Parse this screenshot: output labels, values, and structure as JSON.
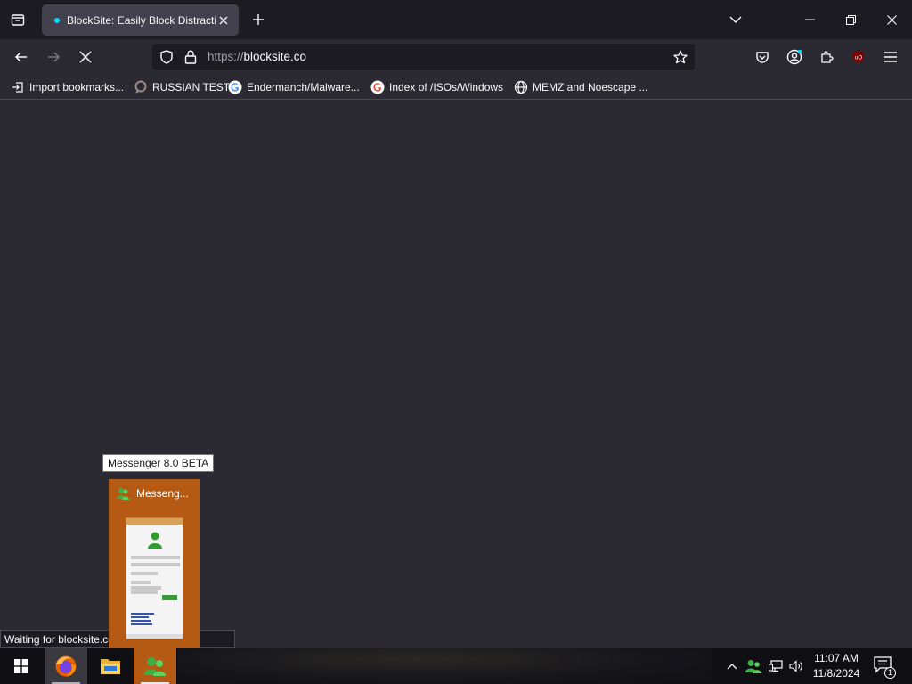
{
  "browser": {
    "active_tab_title": "BlockSite: Easily Block Distractio",
    "url_scheme": "https://",
    "url_host": "blocksite.co",
    "status_text": "Waiting for blocksite.co...",
    "colors": {
      "accent": "#00ddff",
      "chrome": "#1c1b22",
      "page": "#2b2a33"
    }
  },
  "bookmarks": [
    {
      "label": "Import bookmarks...",
      "icon": "import-icon"
    },
    {
      "label": "RUSSIAN TEST",
      "icon": "site-favicon"
    },
    {
      "label": "Endermanch/Malware...",
      "icon": "google-icon"
    },
    {
      "label": "Index of /ISOs/Windows",
      "icon": "google-icon"
    },
    {
      "label": "MEMZ and Noescape ...",
      "icon": "globe-icon"
    }
  ],
  "taskbar": {
    "preview_tooltip": "Messenger 8.0 BETA",
    "preview_title": "Messeng...",
    "clock_time": "11:07 AM",
    "clock_date": "11/8/2024",
    "notification_count": "1",
    "apps": [
      "firefox-icon",
      "file-explorer-icon",
      "messenger-icon"
    ]
  }
}
